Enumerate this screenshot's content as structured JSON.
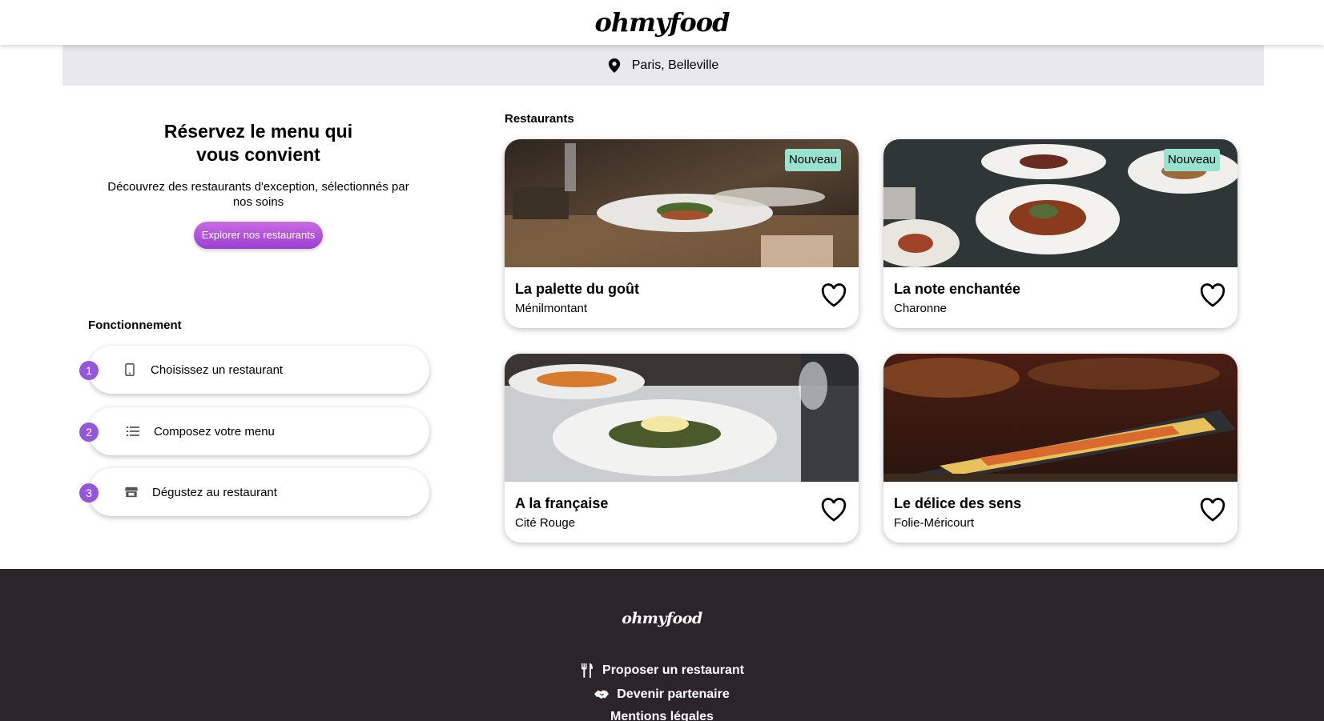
{
  "header": {
    "logo": "ohmyfood"
  },
  "location": {
    "icon": "map-pin-icon",
    "text": "Paris, Belleville"
  },
  "hero": {
    "title": "Réservez le menu qui vous convient",
    "description": "Découvrez des restaurants d'exception, sélectionnés par nos soins",
    "cta_label": "Explorer nos restaurants"
  },
  "how": {
    "title": "Fonctionnement",
    "steps": [
      {
        "number": "1",
        "icon": "phone-icon",
        "label": "Choisissez un restaurant"
      },
      {
        "number": "2",
        "icon": "list-icon",
        "label": "Composez votre menu"
      },
      {
        "number": "3",
        "icon": "store-icon",
        "label": "Dégustez au restaurant"
      }
    ]
  },
  "restaurants": {
    "title": "Restaurants",
    "items": [
      {
        "name": "La palette du goût",
        "area": "Ménilmontant",
        "badge": "Nouveau"
      },
      {
        "name": "La note enchantée",
        "area": "Charonne",
        "badge": "Nouveau"
      },
      {
        "name": "A la française",
        "area": "Cité Rouge",
        "badge": ""
      },
      {
        "name": "Le délice des sens",
        "area": "Folie-Méricourt",
        "badge": ""
      }
    ]
  },
  "footer": {
    "logo": "ohmyfood",
    "links": [
      {
        "icon": "utensils-icon",
        "label": "Proposer un restaurant"
      },
      {
        "icon": "handshake-icon",
        "label": "Devenir partenaire"
      },
      {
        "icon": "",
        "label": "Mentions légales"
      }
    ]
  },
  "colors": {
    "accent": "#9356dc",
    "badge": "#99e2d0",
    "footer_bg": "#2b2529",
    "location_bg": "#e9e8ec"
  }
}
